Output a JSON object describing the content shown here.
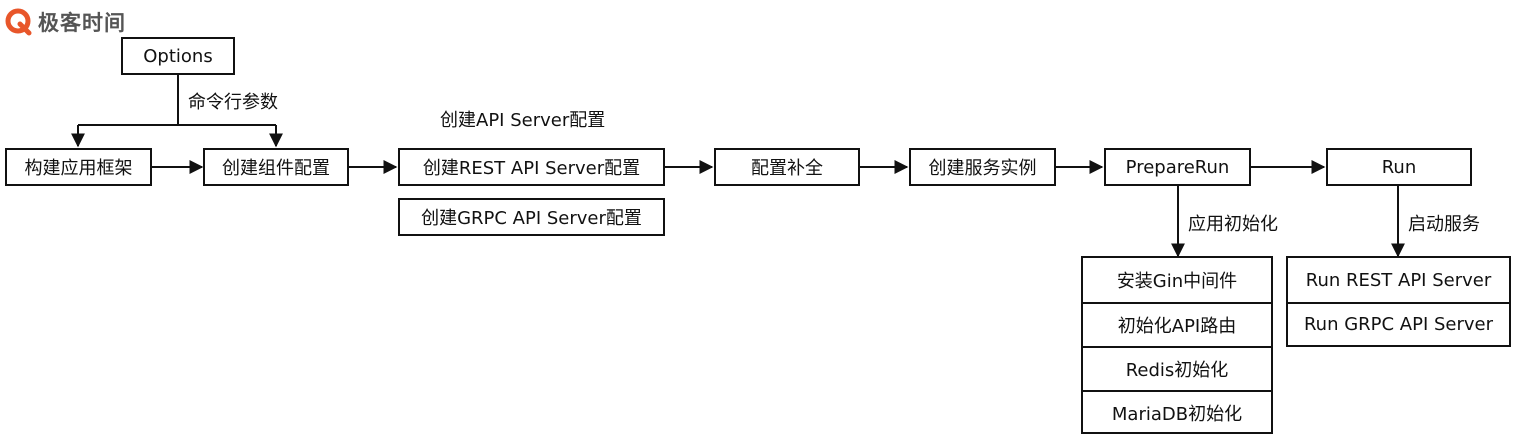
{
  "logo": {
    "text": "极客时间",
    "brand_color": "#e8562a"
  },
  "nodes": {
    "options": "Options",
    "build_framework": "构建应用框架",
    "create_component_config": "创建组件配置",
    "create_rest_config": "创建REST API Server配置",
    "create_grpc_config": "创建GRPC API Server配置",
    "config_complete": "配置补全",
    "create_service_instance": "创建服务实例",
    "prepare_run": "PrepareRun",
    "run": "Run"
  },
  "labels": {
    "cli_args": "命令行参数",
    "create_api_server_config": "创建API Server配置",
    "app_init": "应用初始化",
    "start_service": "启动服务"
  },
  "init_steps": [
    "安装Gin中间件",
    "初始化API路由",
    "Redis初始化",
    "MariaDB初始化"
  ],
  "run_steps": [
    "Run REST API Server",
    "Run GRPC API Server"
  ]
}
